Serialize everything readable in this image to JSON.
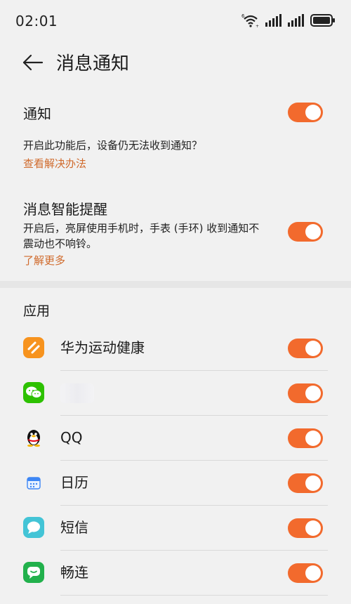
{
  "status_bar": {
    "time": "02:01",
    "icons": [
      "wifi-6-icon",
      "signal-icon",
      "signal-icon",
      "battery-icon"
    ]
  },
  "header": {
    "title": "消息通知",
    "back_icon": "arrow-left-icon"
  },
  "settings": {
    "notification": {
      "title": "通知",
      "description": "开启此功能后，设备仍无法收到通知？",
      "link": "查看解决办法",
      "enabled": true
    },
    "smart_reminder": {
      "title": "消息智能提醒",
      "description_line1": "开启后，亮屏使用手机时，手表 (手环) 收到通知不",
      "description_line2": "震动也不响铃。",
      "link": "了解更多",
      "enabled": true
    }
  },
  "apps": {
    "header": "应用",
    "items": [
      {
        "name": "华为运动健康",
        "icon": "huawei-health-icon",
        "enabled": true
      },
      {
        "name": "",
        "icon": "wechat-icon",
        "enabled": true
      },
      {
        "name": "QQ",
        "icon": "qq-penguin-icon",
        "enabled": true
      },
      {
        "name": "日历",
        "icon": "calendar-icon",
        "enabled": true
      },
      {
        "name": "短信",
        "icon": "messages-icon",
        "enabled": true
      },
      {
        "name": "畅连",
        "icon": "meetime-icon",
        "enabled": true
      }
    ]
  },
  "colors": {
    "accent": "#f26a2d",
    "link": "#d06a2c",
    "background": "#f1f1f1"
  }
}
